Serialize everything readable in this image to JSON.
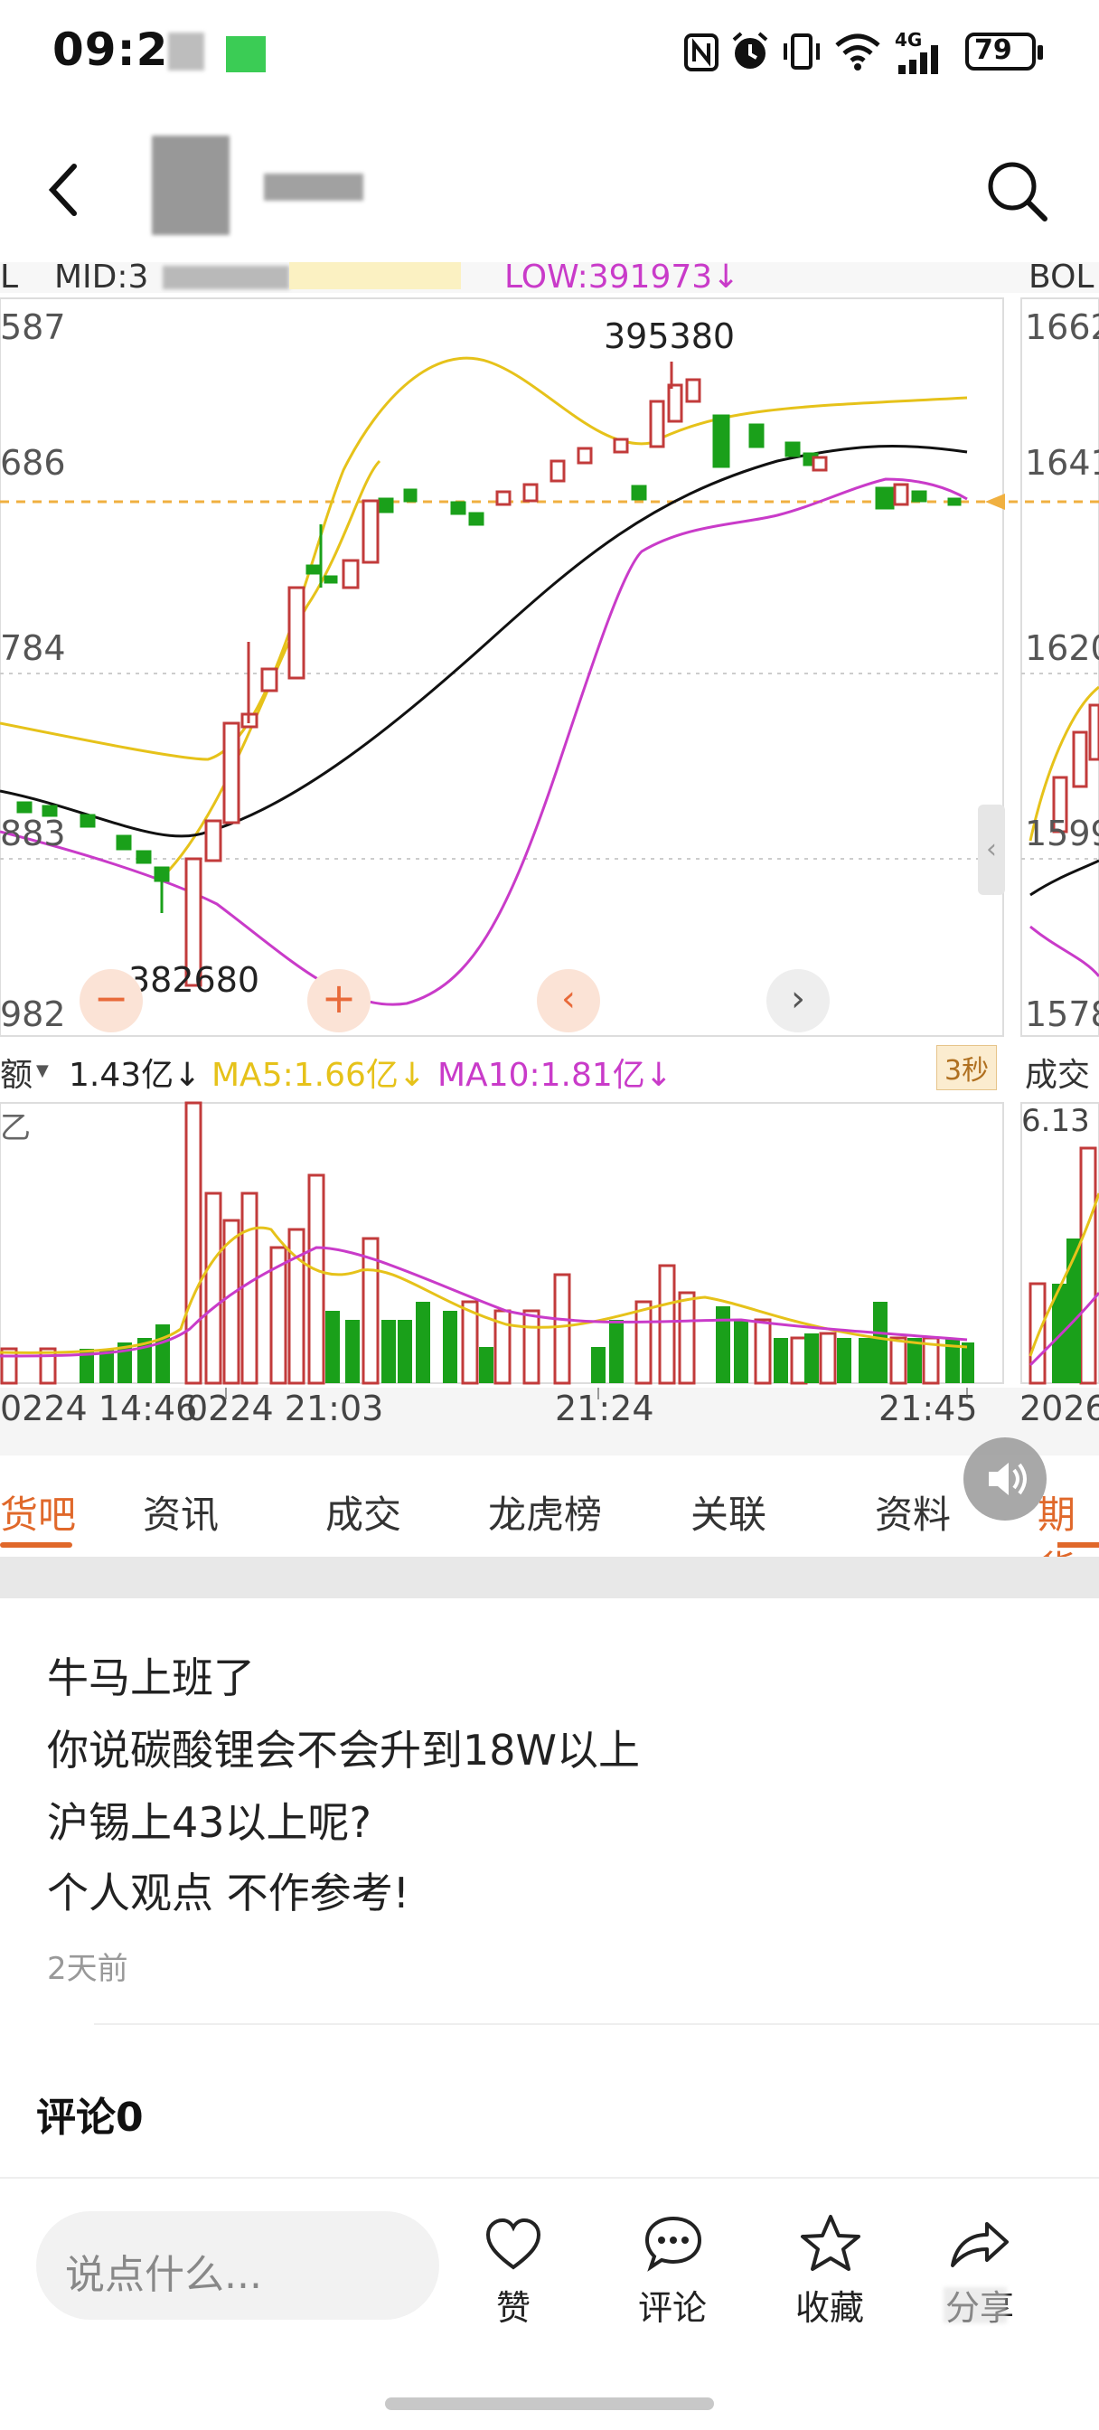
{
  "status_bar": {
    "time": "09:2",
    "battery": "79",
    "network": "4G"
  },
  "header": {
    "back_icon": "chevron-left-icon",
    "search_icon": "search-icon"
  },
  "chart": {
    "top_indicator": {
      "prefix": "L",
      "mid_label": "MID:3",
      "low_label": "LOW:391973↓"
    },
    "right_indicator": "BOL",
    "price_ticks": [
      "587",
      "686",
      "784",
      "883",
      "982"
    ],
    "right_ticks": [
      "1662",
      "1641",
      "1620",
      "1599",
      "1578"
    ],
    "high_annotation": "395380",
    "low_annotation": "382680",
    "volume_legend": {
      "name": "额",
      "value": "1.43亿↓",
      "ma5": "MA5:1.66亿↓",
      "ma10": "MA10:1.81亿↓",
      "badge": "3秒"
    },
    "volume_axis_label": "乙",
    "right_volume_label": "成交",
    "right_volume_value": "6.13",
    "time_ticks": [
      "0224 14:46",
      "0224 21:03",
      "21:24",
      "21:45"
    ],
    "right_time_tick": "2026",
    "colors": {
      "up": "#c23b3b",
      "down": "#1aa01a",
      "ma_yellow": "#e6c21a",
      "ma_magenta": "#c93bc9",
      "mid_black": "#111111",
      "price_line": "#f0a030"
    }
  },
  "chart_data": {
    "type": "candlestick",
    "high": 395380,
    "low": 382680,
    "volume_current": "1.43亿",
    "ma5": "1.66亿",
    "ma10": "1.81亿"
  },
  "tabs": [
    "货吧",
    "资讯",
    "成交",
    "龙虎榜",
    "关联",
    "资料",
    "期货"
  ],
  "post": {
    "lines": [
      "牛马上班了",
      "你说碳酸锂会不会升到18W以上",
      "沪锡上43以上呢?",
      "个人观点 不作参考!"
    ],
    "time": "2天前"
  },
  "comments": {
    "title": "评论0"
  },
  "bottom_bar": {
    "input_placeholder": "说点什么...",
    "like": "赞",
    "comment": "评论",
    "favorite": "收藏",
    "share": "分享"
  }
}
